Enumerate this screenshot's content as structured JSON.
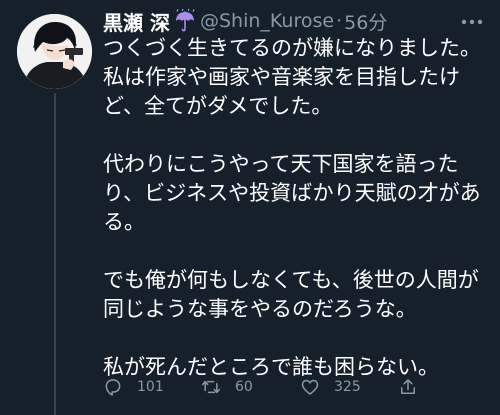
{
  "tweet": {
    "author": {
      "display_name": "黒瀬 深",
      "name_emoji": "umbrella-with-rain-icon",
      "handle": "@Shin_Kurose",
      "separator": "·",
      "timestamp": "56分"
    },
    "paragraphs": [
      "つくづく生きてるのが嫌になりました。私は作家や画家や音楽家を目指したけど、全てがダメでした。",
      "代わりにこうやって天下国家を語ったり、ビジネスや投資ばかり天賦の才がある。",
      "でも俺が何もしなくても、後世の人間が同じような事をやるのだろうな。",
      "私が死んだところで誰も困らない。"
    ],
    "actions": {
      "replies": "101",
      "retweets": "60",
      "likes": "325"
    }
  },
  "colors": {
    "background": "#15202b",
    "text_primary": "#ffffff",
    "text_secondary": "#8899a6",
    "thread_line": "#38444d",
    "umbrella": "#a98ef0"
  }
}
